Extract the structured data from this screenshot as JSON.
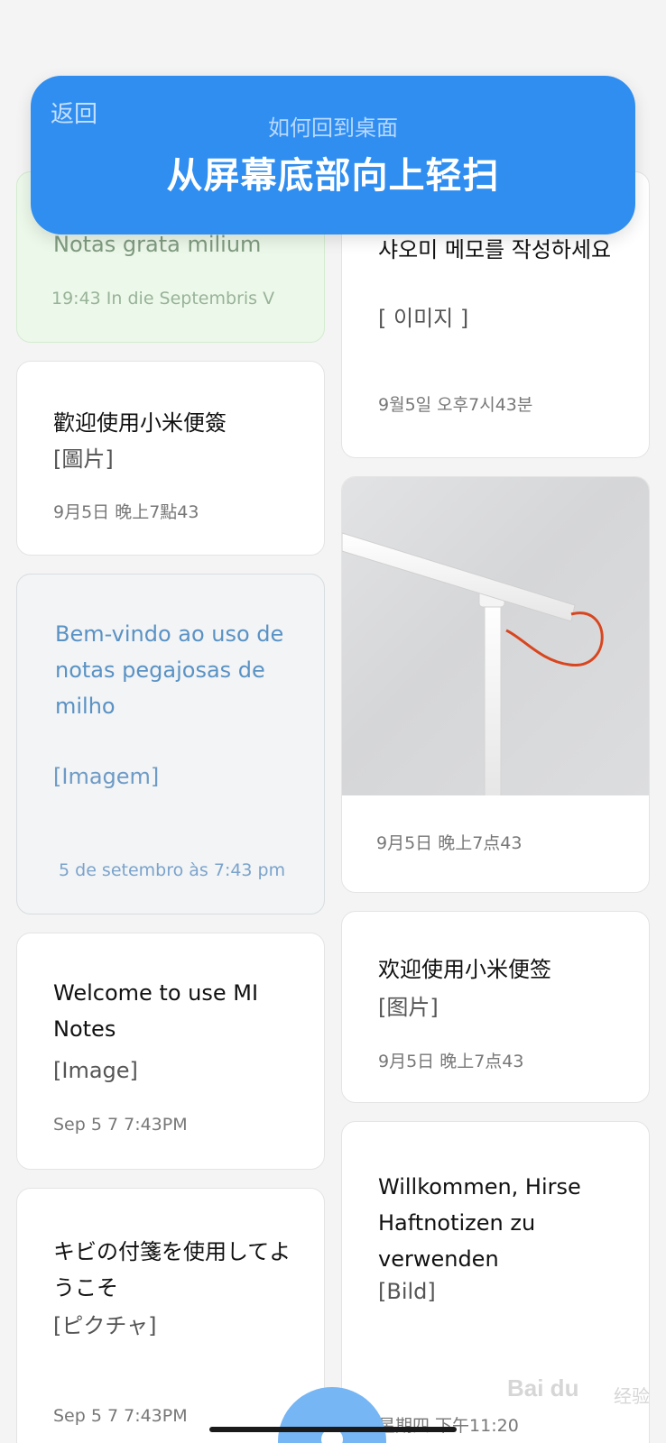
{
  "banner": {
    "back_label": "返回",
    "subtitle": "如何回到桌面",
    "title": "从屏幕底部向上轻扫",
    "color": "#2f8ef0"
  },
  "notes": {
    "latin": {
      "title": "Notas grata milium",
      "time": "19:43 In die Septembris V"
    },
    "traditional_chinese": {
      "title": "歡迎使用小米便簽",
      "tag": "[圖片]",
      "time": "9月5日 晚上7點43"
    },
    "portuguese": {
      "title": "Bem-vindo ao uso de notas pegajosas de milho",
      "tag": "[Imagem]",
      "time": "5 de setembro às 7:43 pm"
    },
    "english": {
      "title": "Welcome to use MI Notes",
      "tag": "[Image]",
      "time": "Sep 5 7 7:43PM"
    },
    "japanese": {
      "title": "キビの付箋を使用してようこそ",
      "tag": "[ピクチャ]",
      "time": "Sep 5 7 7:43PM"
    },
    "korean": {
      "title": "샤오미 메모를 작성하세요",
      "tag": "[ 이미지 ]",
      "time": "9월5일  오후7시43분"
    },
    "photo": {
      "time": "9月5日 晚上7点43"
    },
    "simplified_chinese": {
      "title": "欢迎使用小米便签",
      "tag": "[图片]",
      "time": "9月5日 晚上7点43"
    },
    "german": {
      "title": "Willkommen, Hirse Haftnotizen zu verwenden",
      "tag": "[Bild]",
      "time": "星期四 下午11:20"
    }
  },
  "watermark": {
    "text": "Bai du",
    "sub": "经验"
  }
}
